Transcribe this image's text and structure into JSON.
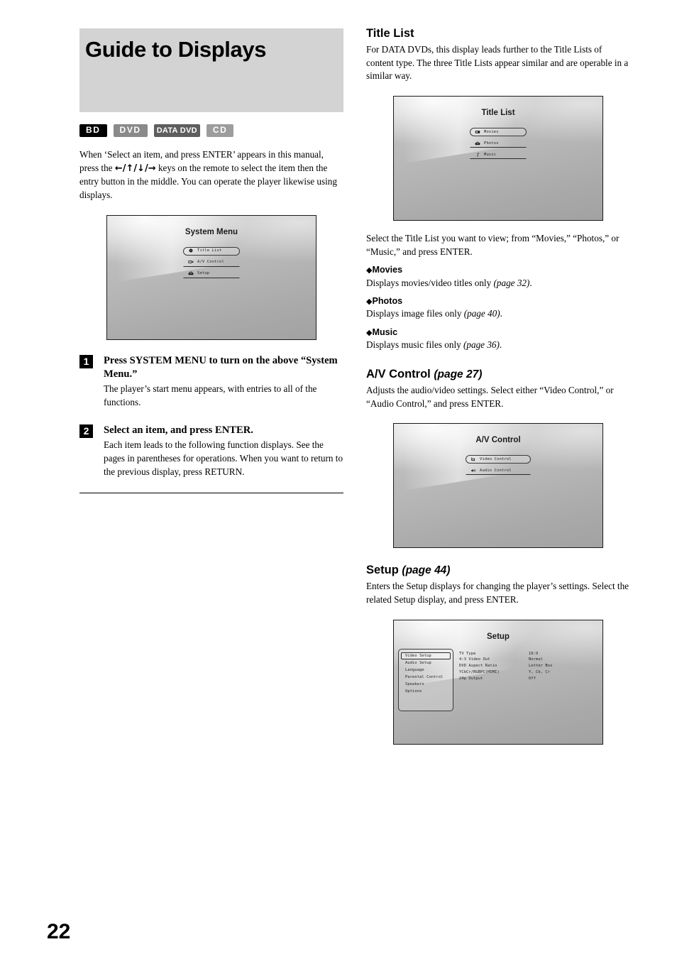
{
  "page_number": "22",
  "left_column": {
    "title": "Guide to Displays",
    "badges": [
      {
        "label": "BD",
        "color": "#000000"
      },
      {
        "label": "DVD",
        "color": "#8a8a8a"
      },
      {
        "label": "DATA DVD",
        "color": "#5e5e5e"
      },
      {
        "label": "CD",
        "color": "#9d9d9d"
      }
    ],
    "intro_part1": "When ‘Select an item, and press ENTER’ appears in this manual, press the ",
    "intro_keys": "←/↑/↓/→",
    "intro_part2": " keys on the remote to select the item then the entry button in the middle. You can operate the player likewise using displays.",
    "system_menu_screen": {
      "title": "System Menu",
      "items": [
        {
          "label": "Title List",
          "icon": "disc-icon",
          "selected": true
        },
        {
          "label": "A/V Control",
          "icon": "monitor-icon",
          "selected": false
        },
        {
          "label": "Setup",
          "icon": "toolbox-icon",
          "selected": false
        }
      ]
    },
    "steps": [
      {
        "number": "1",
        "heading": "Press SYSTEM MENU to turn on the above “System Menu.”",
        "body": "The player’s start menu appears, with entries to all of the functions."
      },
      {
        "number": "2",
        "heading": "Select an item, and press ENTER.",
        "body": "Each item leads to the following function displays. See the pages in parentheses for operations. When you want to return to the previous display, press RETURN."
      }
    ]
  },
  "right_column": {
    "title_list": {
      "heading": "Title List",
      "intro": "For DATA DVDs, this display leads further to the Title Lists of content type. The three Title Lists appear similar and are operable in a similar way.",
      "screen": {
        "title": "Title List",
        "items": [
          {
            "label": "Movies",
            "icon": "film-screen-icon",
            "selected": true
          },
          {
            "label": "Photos",
            "icon": "camera-icon",
            "selected": false
          },
          {
            "label": "Music",
            "icon": "music-note-icon",
            "selected": false
          }
        ]
      },
      "after_screen": "Select the Title List you want to view; from “Movies,” “Photos,” or “Music,” and press ENTER.",
      "bullets": [
        {
          "title": "Movies",
          "desc_main": "Displays movies/video titles only ",
          "desc_page": "(page 32)",
          "desc_end": "."
        },
        {
          "title": "Photos",
          "desc_main": "Displays image files only ",
          "desc_page": "(page 40)",
          "desc_end": "."
        },
        {
          "title": "Music",
          "desc_main": "Displays music files only ",
          "desc_page": "(page 36)",
          "desc_end": "."
        }
      ]
    },
    "av_control": {
      "heading": "A/V Control ",
      "heading_page": "(page 27)",
      "intro": "Adjusts the audio/video settings. Select either “Video Control,” or “Audio Control,” and press ENTER.",
      "screen": {
        "title": "A/V Control",
        "items": [
          {
            "label": "Video Control",
            "icon": "video-monitor-icon",
            "selected": true
          },
          {
            "label": "Audio Control",
            "icon": "speaker-icon",
            "selected": false
          }
        ]
      }
    },
    "setup": {
      "heading": "Setup ",
      "heading_page": "(page 44)",
      "intro": "Enters the Setup displays for changing the player’s settings. Select the related Setup display, and press ENTER.",
      "screen": {
        "title": "Setup",
        "sidebar": [
          {
            "label": "Video Setup",
            "selected": true
          },
          {
            "label": "Audio Setup",
            "selected": false
          },
          {
            "label": "Language",
            "selected": false
          },
          {
            "label": "Parental Control",
            "selected": false
          },
          {
            "label": "Speakers",
            "selected": false
          },
          {
            "label": "Options",
            "selected": false
          }
        ],
        "settings": [
          {
            "key": "TV Type",
            "value": "16:9"
          },
          {
            "key": "4:3 Video Out",
            "value": "Normal"
          },
          {
            "key": "DVD Aspect Ratio",
            "value": "Letter Box"
          },
          {
            "key": "YCbCr/RGBPC(HDMI)",
            "value": "Y, Cb, Cr"
          },
          {
            "key": "24p Output",
            "value": "Off"
          }
        ]
      }
    }
  }
}
